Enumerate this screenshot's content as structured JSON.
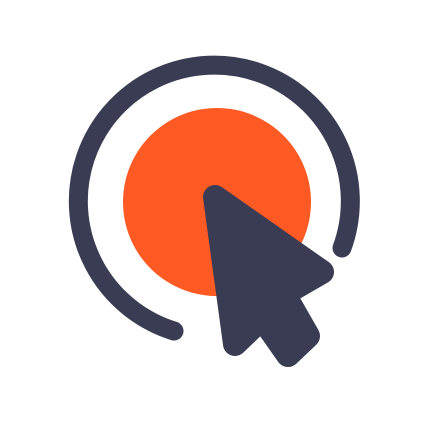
{
  "icon": {
    "name": "click-cursor-icon",
    "colors": {
      "background": "#ffffff",
      "accent": "#ff5a23",
      "dark": "#3a3c53"
    }
  }
}
